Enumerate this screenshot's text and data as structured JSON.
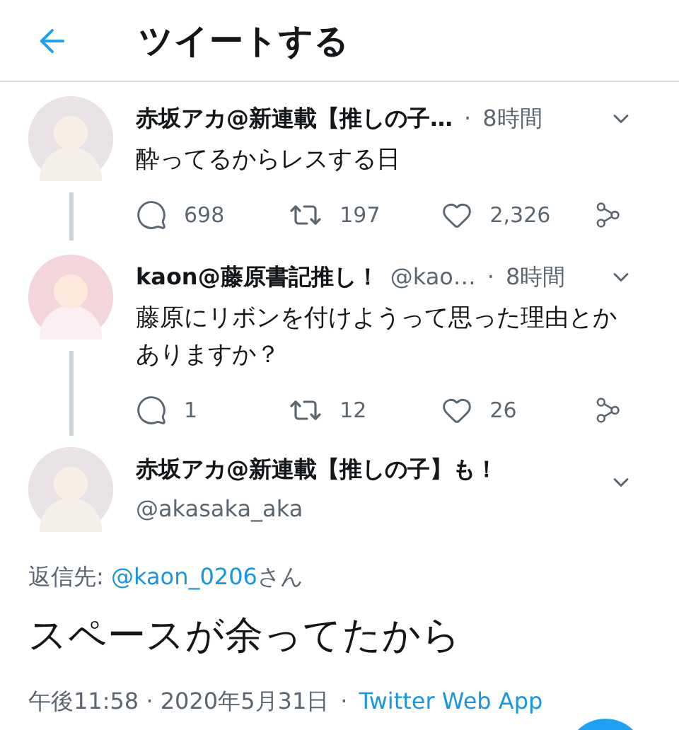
{
  "header": {
    "title": "ツイートする"
  },
  "tweets": [
    {
      "name": "赤坂アカ@新連載【推しの子…",
      "separator": "·",
      "time": "8時間",
      "text": "酔ってるからレスする日",
      "replies": "698",
      "retweets": "197",
      "likes": "2,326"
    },
    {
      "name": "kaon@藤原書記推し！",
      "handle": "@kao…",
      "separator": "·",
      "time": "8時間",
      "text": "藤原にリボンを付けようって思った理由とかありますか？",
      "replies": "1",
      "retweets": "12",
      "likes": "26"
    }
  ],
  "focused": {
    "name": "赤坂アカ@新連載【推しの子】も！",
    "handle": "@akasaka_aka",
    "reply_label": "返信先:",
    "reply_handle": "@kaon_0206",
    "reply_suffix": "さん",
    "text": "スペースが余ってたから",
    "timestamp": "午後11:58 · 2020年5月31日",
    "separator": "·",
    "source": "Twitter Web App"
  }
}
